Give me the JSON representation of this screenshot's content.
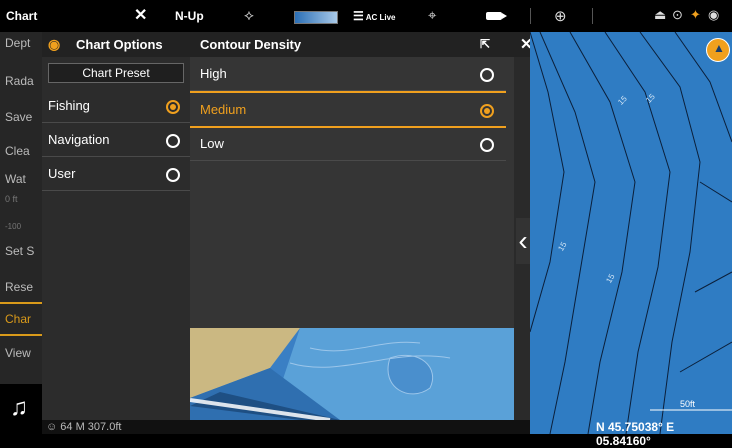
{
  "topbar": {
    "app_title": "Chart",
    "close_symbol": "✕",
    "orientation": "N-Up",
    "ac_live_label": "AC Live",
    "accent": "#f0a01e"
  },
  "left_menu": {
    "items": [
      {
        "label": "Dept",
        "accent": false
      },
      {
        "label": "Rada",
        "accent": false
      },
      {
        "label": "Save",
        "accent": false
      },
      {
        "label": "Clea",
        "accent": false
      },
      {
        "label": "Wat",
        "accent": false
      },
      {
        "label": "0 ft",
        "accent": false
      },
      {
        "label": "-100",
        "accent": false
      },
      {
        "label": "Set S",
        "accent": false
      },
      {
        "label": "Rese",
        "accent": false
      },
      {
        "label": "Char",
        "accent": true
      },
      {
        "label": "View",
        "accent": false
      }
    ]
  },
  "chart_options": {
    "title": "Chart Options",
    "preset_button": "Chart Preset",
    "presets": [
      {
        "label": "Fishing",
        "selected": true
      },
      {
        "label": "Navigation",
        "selected": false
      },
      {
        "label": "User",
        "selected": false
      }
    ]
  },
  "contour_density": {
    "title": "Contour Density",
    "close_symbol": "✕",
    "options": [
      {
        "label": "High",
        "selected": false
      },
      {
        "label": "Medium",
        "selected": true
      },
      {
        "label": "Low",
        "selected": false
      }
    ]
  },
  "map": {
    "scale_label": "50ft",
    "contour_labels": [
      "15",
      "15",
      "15",
      "15"
    ],
    "coordinates": "N 45.75038° E 05.84160°"
  },
  "bottom": {
    "readout": "☺ 64 M  307.0ft"
  }
}
